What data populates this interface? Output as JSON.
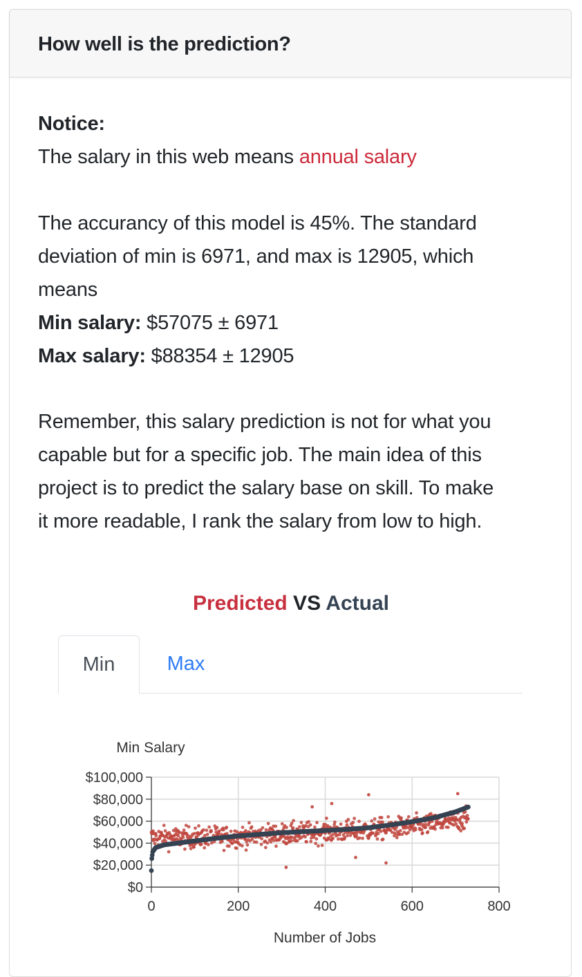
{
  "card": {
    "title": "How well is the prediction?"
  },
  "notice": {
    "label": "Notice:",
    "text_prefix": "The salary in this web means ",
    "highlight": "annual salary"
  },
  "accuracy": {
    "line1": "The accurancy of this model is 45%. The standard",
    "line2": "deviation of min is 6971, and max is 12905, which",
    "line3": "means",
    "min_label": "Min salary:",
    "min_value": " $57075 ± 6971",
    "max_label": "Max salary:",
    "max_value": " $88354 ± 12905"
  },
  "remember": {
    "line1": "Remember, this salary prediction is not for what you",
    "line2": "capable but for a specific job. The main idea of this",
    "line3": "project is to predict the salary base on skill. To make",
    "line4": "it more readable, I rank the salary from low to high."
  },
  "chart_heading": {
    "predicted": "Predicted",
    "vs": " VS ",
    "actual": "Actual"
  },
  "tabs": [
    {
      "label": "Min",
      "active": true
    },
    {
      "label": "Max",
      "active": false
    }
  ],
  "colors": {
    "predicted": "#c0463e",
    "actual": "#354353",
    "accent_red": "#cc2b3b",
    "link_blue": "#2f7cf6"
  },
  "chart_data": {
    "type": "scatter",
    "title": "Min Salary",
    "xlabel": "Number of Jobs",
    "ylabel": "",
    "xlim": [
      0,
      800
    ],
    "ylim": [
      0,
      100000
    ],
    "x_ticks": [
      "0",
      "200",
      "400",
      "600",
      "800"
    ],
    "y_ticks": [
      "$0",
      "$20,000",
      "$40,000",
      "$60,000",
      "$80,000",
      "$100,000"
    ],
    "grid": true,
    "n_points": 730,
    "series": [
      {
        "name": "Predicted",
        "style": "scattered points",
        "trend_x": [
          0,
          100,
          200,
          300,
          400,
          500,
          600,
          700,
          730
        ],
        "trend_y": [
          45000,
          45000,
          46000,
          48000,
          50000,
          52000,
          55000,
          60000,
          62000
        ],
        "spread": 9000,
        "outliers": [
          {
            "x": 310,
            "y": 18000
          },
          {
            "x": 500,
            "y": 84000
          },
          {
            "x": 705,
            "y": 85000
          },
          {
            "x": 470,
            "y": 27000
          },
          {
            "x": 540,
            "y": 22000
          },
          {
            "x": 370,
            "y": 73000
          },
          {
            "x": 415,
            "y": 76000
          }
        ]
      },
      {
        "name": "Actual",
        "style": "ranked line of points",
        "x": [
          0,
          1,
          3,
          10,
          30,
          60,
          100,
          150,
          200,
          250,
          300,
          350,
          400,
          450,
          500,
          550,
          600,
          650,
          700,
          730
        ],
        "y": [
          15000,
          26000,
          32000,
          36000,
          38500,
          40000,
          42000,
          44500,
          46500,
          48000,
          49500,
          50500,
          51500,
          52500,
          54000,
          56500,
          59500,
          63000,
          68500,
          73000
        ]
      }
    ]
  }
}
